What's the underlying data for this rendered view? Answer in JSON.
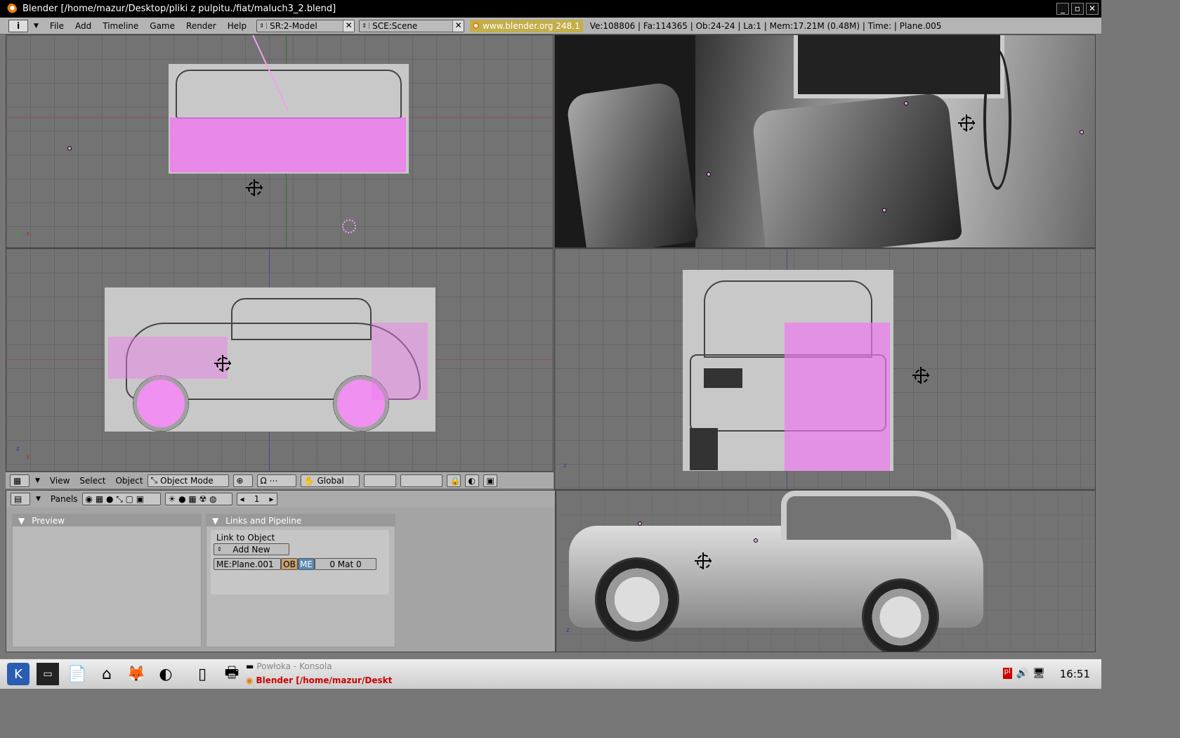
{
  "window": {
    "title": "Blender [/home/mazur/Desktop/pliki z pulpitu./fiat/maluch3_2.blend]",
    "buttons": [
      "_",
      "▫",
      "✕"
    ]
  },
  "menubar": {
    "info_label": "i",
    "menus": [
      "File",
      "Add",
      "Timeline",
      "Game",
      "Render",
      "Help"
    ],
    "screen": "SR:2-Model",
    "scene": "SCE:Scene",
    "website": "www.blender.org 248.1",
    "stats": "Ve:108806 | Fa:114365 | Ob:24-24 | La:1  | Mem:17.21M (0.48M)  | Time: | Plane.005"
  },
  "view3d_header": {
    "menus": [
      "View",
      "Select",
      "Object"
    ],
    "mode": "Object Mode",
    "orientation": "Global"
  },
  "buttons_header": {
    "panels_label": "Panels",
    "frame": "1"
  },
  "panels": {
    "preview": {
      "title": "Preview"
    },
    "links": {
      "title": "Links and Pipeline",
      "link_to_object": "Link to Object",
      "add_new": "Add New",
      "mesh": "ME:Plane.001",
      "ob": "OB",
      "me": "ME",
      "mat": "0 Mat 0"
    }
  },
  "axes": {
    "x": "x",
    "y": "y",
    "z": "z"
  },
  "taskbar": {
    "tasks": [
      "Powłoka - Konsola",
      "Blender [/home/mazur/Deskt"
    ],
    "clock": "16:51",
    "lang": "pl"
  }
}
